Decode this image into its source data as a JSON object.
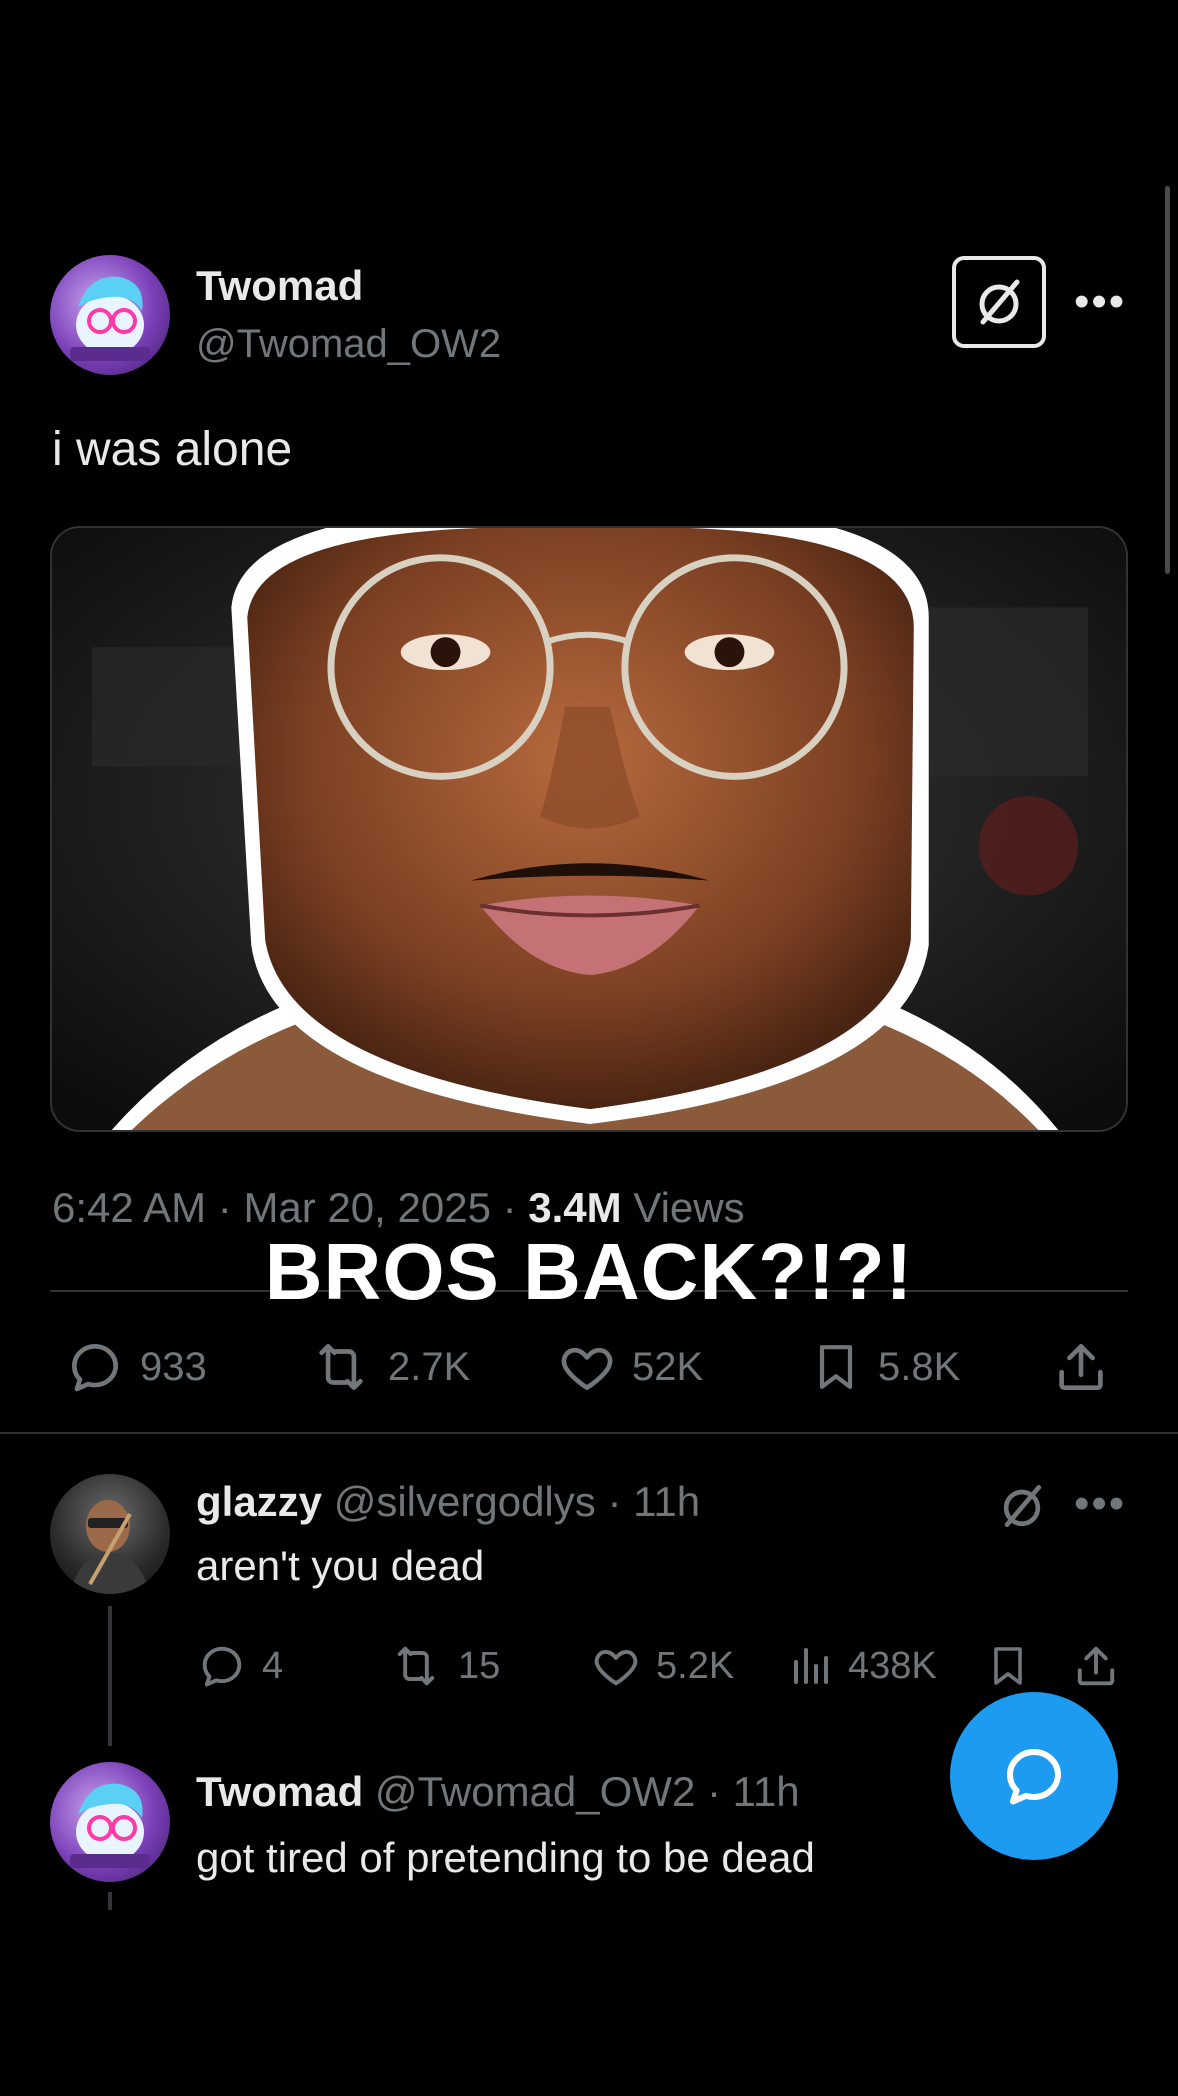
{
  "main_tweet": {
    "display_name": "Twomad",
    "handle": "@Twomad_OW2",
    "text": "i was alone",
    "time": "6:42 AM",
    "date": "Mar 20, 2025",
    "views_count": "3.4M",
    "views_label": "Views",
    "stats": {
      "replies": "933",
      "reposts": "2.7K",
      "likes": "52K",
      "bookmarks": "5.8K"
    }
  },
  "overlay_caption": "BROS BACK?!?!",
  "replies": [
    {
      "display_name": "glazzy",
      "handle": "@silvergodlys",
      "age": "11h",
      "text": "aren't you dead",
      "stats": {
        "replies": "4",
        "reposts": "15",
        "likes": "5.2K",
        "views": "438K"
      }
    },
    {
      "display_name": "Twomad",
      "handle": "@Twomad_OW2",
      "age": "11h",
      "text": "got tired of pretending to be dead"
    }
  ],
  "colors": {
    "background": "#000000",
    "primary_text": "#e7e9ea",
    "secondary_text": "#71767b",
    "divider": "#2f3336",
    "accent_blue": "#1d9bf0"
  },
  "icons": [
    "grok-icon",
    "more-icon",
    "reply-icon",
    "repost-icon",
    "like-icon",
    "bookmark-icon",
    "share-icon",
    "views-icon",
    "compose-reply-icon"
  ]
}
